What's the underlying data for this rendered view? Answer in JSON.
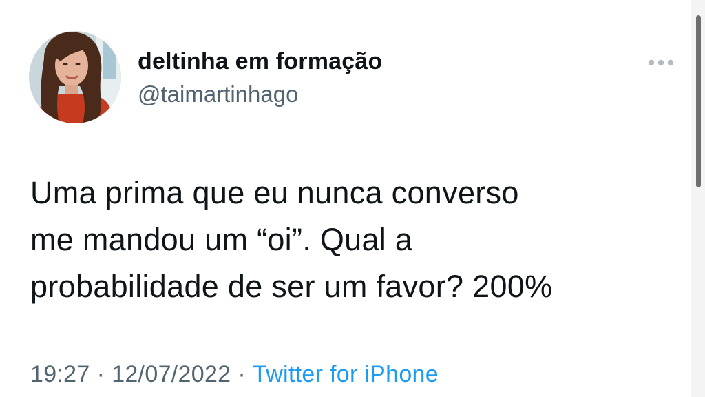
{
  "author": {
    "display_name": "deltinha em formação",
    "handle": "@taimartinhago"
  },
  "tweet": {
    "text": "Uma prima que eu nunca converso\nme mandou um “oi”. Qual a\nprobabilidade de ser um favor? 200%",
    "time": "19:27",
    "date": "12/07/2022",
    "separator": "·",
    "source": "Twitter for iPhone"
  },
  "icons": {
    "more": "more-horizontal-icon",
    "avatar": "profile-photo"
  },
  "colors": {
    "text": "#0f1419",
    "secondary": "#536471",
    "link": "#1d9bf0",
    "scroll_thumb": "#6e6e6e"
  }
}
